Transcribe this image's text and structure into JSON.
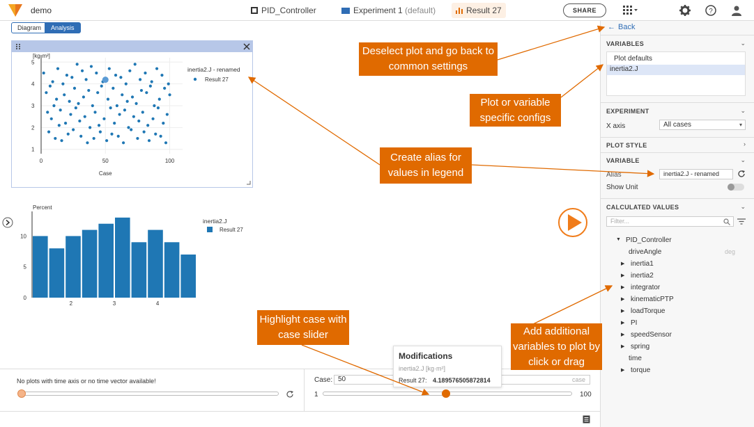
{
  "app": {
    "title": "demo"
  },
  "topnav": {
    "model": "PID_Controller",
    "experiment": "Experiment 1",
    "experiment_suffix": "(default)",
    "result": "Result 27",
    "share": "SHARE"
  },
  "view_tabs": {
    "diagram": "Diagram",
    "analysis": "Analysis"
  },
  "plot1": {
    "chart_data": {
      "type": "scatter",
      "ylabel": "[kg·m²]",
      "xlabel": "Case",
      "legend_title": "inertia2.J - renamed",
      "series_name": "Result 27",
      "xlim": [
        0,
        110
      ],
      "ylim": [
        0.8,
        5.2
      ],
      "xticks": [
        0,
        50,
        100
      ],
      "yticks": [
        1,
        2,
        3,
        4,
        5
      ],
      "highlight": {
        "x": 50,
        "y": 4.19
      },
      "x": [
        2,
        4,
        5,
        6,
        7,
        8,
        9,
        10,
        11,
        12,
        13,
        14,
        15,
        16,
        17,
        18,
        19,
        20,
        21,
        22,
        23,
        24,
        25,
        26,
        27,
        28,
        29,
        30,
        31,
        32,
        33,
        34,
        35,
        36,
        37,
        38,
        39,
        40,
        41,
        42,
        43,
        44,
        45,
        46,
        47,
        48,
        49,
        51,
        52,
        53,
        54,
        55,
        56,
        57,
        58,
        59,
        60,
        61,
        62,
        63,
        64,
        65,
        66,
        67,
        68,
        69,
        70,
        71,
        72,
        73,
        74,
        75,
        76,
        77,
        78,
        79,
        80,
        81,
        82,
        83,
        84,
        85,
        86,
        87,
        88,
        89,
        90,
        91,
        92,
        93,
        94,
        95,
        96,
        97,
        98,
        99,
        100
      ],
      "y": [
        4.5,
        3.6,
        2.7,
        1.8,
        3.9,
        2.4,
        4.1,
        3.0,
        1.5,
        3.3,
        4.7,
        2.1,
        2.8,
        1.4,
        4.0,
        3.5,
        2.2,
        4.4,
        1.7,
        3.2,
        2.6,
        4.3,
        1.9,
        3.8,
        2.9,
        4.9,
        3.1,
        2.3,
        1.6,
        4.6,
        3.4,
        2.5,
        4.2,
        1.3,
        3.7,
        2.0,
        4.8,
        3.0,
        1.5,
        2.7,
        4.5,
        3.6,
        2.1,
        1.8,
        3.9,
        4.1,
        2.4,
        1.4,
        3.3,
        4.7,
        2.9,
        1.7,
        3.8,
        2.2,
        4.4,
        3.0,
        1.6,
        2.6,
        4.3,
        3.5,
        1.3,
        2.8,
        4.0,
        3.2,
        2.0,
        4.6,
        1.9,
        3.4,
        2.5,
        4.9,
        3.1,
        1.5,
        2.3,
        4.2,
        3.7,
        2.7,
        1.8,
        4.5,
        3.6,
        2.1,
        1.4,
        3.9,
        4.1,
        2.4,
        3.0,
        1.7,
        4.7,
        2.9,
        3.3,
        1.6,
        4.4,
        2.2,
        3.8,
        1.3,
        2.6,
        4.0,
        3.5
      ]
    }
  },
  "plot2": {
    "chart_data": {
      "type": "bar",
      "ylabel": "Percent",
      "legend_title": "inertia2.J",
      "series_name": "Result 27",
      "values": [
        10,
        8,
        10,
        11,
        12,
        13,
        9,
        11,
        9,
        7
      ],
      "xlim": [
        1.1,
        4.9
      ],
      "ylim": [
        0,
        14
      ],
      "xticks": [
        2,
        3,
        4
      ],
      "yticks": [
        0,
        5,
        10
      ]
    }
  },
  "bottom": {
    "no_time_msg": "No plots with time axis or no time vector available!",
    "case_label": "Case:",
    "case_value": "50",
    "case_unit": "case",
    "min": "1",
    "max": "100",
    "slider_fraction": 0.495
  },
  "tooltip": {
    "title": "Modifications",
    "variable": "inertia2.J [kg·m²]",
    "result_label": "Result 27:",
    "result_value": "4.189576505872814"
  },
  "sidebar": {
    "back": "Back",
    "variables_head": "VARIABLES",
    "plot_defaults": "Plot defaults",
    "selected_var": "inertia2.J",
    "experiment_head": "EXPERIMENT",
    "xaxis_label": "X axis",
    "xaxis_value": "All cases",
    "plot_style_head": "PLOT STYLE",
    "variable_head": "VARIABLE",
    "alias_label": "Alias",
    "alias_value": "inertia2.J - renamed",
    "show_unit_label": "Show Unit",
    "calc_head": "CALCULATED VALUES",
    "filter_placeholder": "Filter...",
    "tree_root": "PID_Controller",
    "tree": [
      {
        "label": "driveAngle",
        "unit": "deg",
        "expandable": false
      },
      {
        "label": "inertia1",
        "expandable": true
      },
      {
        "label": "inertia2",
        "expandable": true
      },
      {
        "label": "integrator",
        "expandable": true
      },
      {
        "label": "kinematicPTP",
        "expandable": true
      },
      {
        "label": "loadTorque",
        "expandable": true
      },
      {
        "label": "PI",
        "expandable": true
      },
      {
        "label": "speedSensor",
        "expandable": true
      },
      {
        "label": "spring",
        "expandable": true
      },
      {
        "label": "time",
        "expandable": false
      },
      {
        "label": "torque",
        "expandable": true
      }
    ]
  },
  "callouts": {
    "deselect": "Deselect plot and go back to common settings",
    "specific": "Plot or variable specific configs",
    "alias": "Create alias for values in legend",
    "highlight": "Highlight case with case slider",
    "add": "Add additional variables to plot by click or drag"
  },
  "colors": {
    "accent": "#2f6db5",
    "marker": "#1f77b4",
    "callout": "#e06a00",
    "play": "#f07c1a"
  }
}
